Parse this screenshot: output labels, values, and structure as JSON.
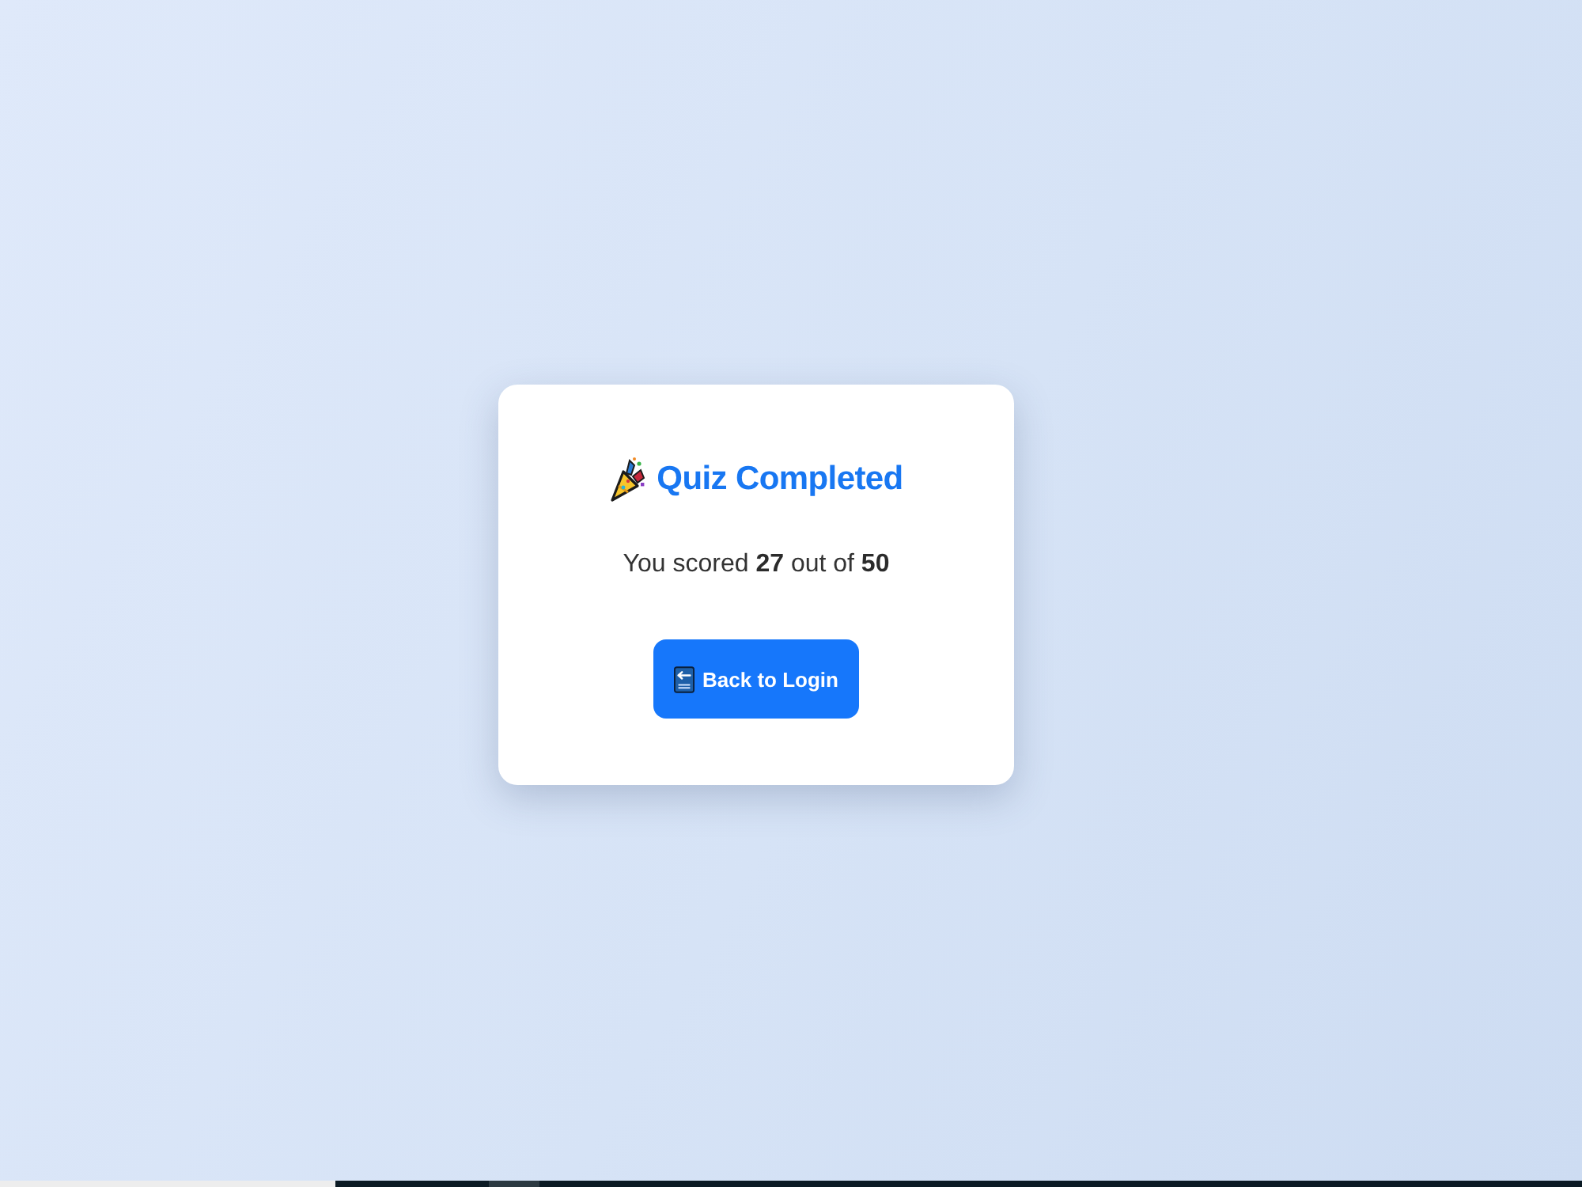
{
  "card": {
    "title": "Quiz Completed",
    "score_text": "You scored **27** out of **50**",
    "button": {
      "label": "Back to Login"
    }
  }
}
